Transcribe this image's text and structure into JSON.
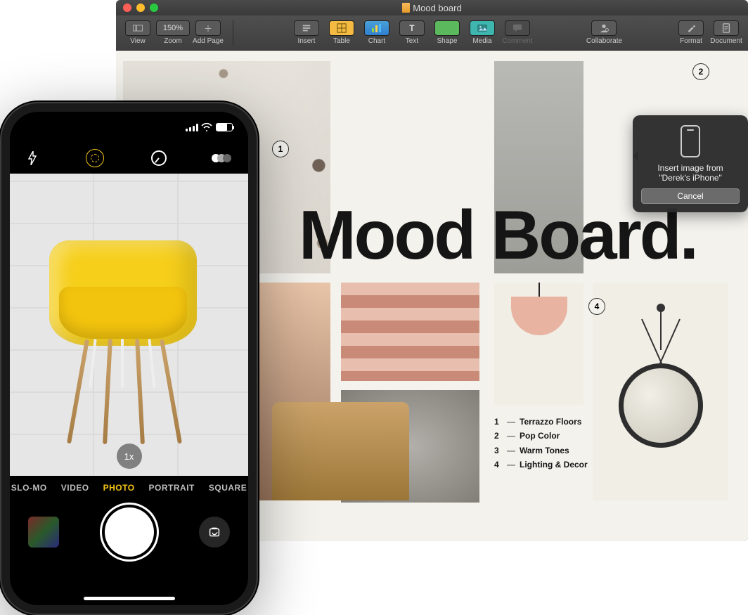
{
  "window": {
    "title": "Mood board",
    "traffic": {
      "close": "#ff5f57",
      "min": "#ffbd2e",
      "max": "#28c840"
    }
  },
  "toolbar": {
    "view": "View",
    "zoom_value": "150%",
    "zoom": "Zoom",
    "add_page": "Add Page",
    "insert": "Insert",
    "table": "Table",
    "chart": "Chart",
    "text": "Text",
    "shape": "Shape",
    "media": "Media",
    "comment": "Comment",
    "collaborate": "Collaborate",
    "format": "Format",
    "document": "Document"
  },
  "doc": {
    "headline": "Mood Board.",
    "callouts": {
      "1": "1",
      "2": "2",
      "4": "4"
    },
    "legend": [
      {
        "n": "1",
        "label": "Terrazzo Floors"
      },
      {
        "n": "2",
        "label": "Pop Color"
      },
      {
        "n": "3",
        "label": "Warm Tones"
      },
      {
        "n": "4",
        "label": "Lighting & Decor"
      }
    ]
  },
  "popover": {
    "line1": "Insert image from",
    "line2": "\"Derek's iPhone\"",
    "cancel": "Cancel"
  },
  "iphone": {
    "camera": {
      "zoom": "1x",
      "modes": {
        "slomo": "SLO-MO",
        "video": "VIDEO",
        "photo": "PHOTO",
        "portrait": "PORTRAIT",
        "square": "SQUARE"
      }
    }
  }
}
